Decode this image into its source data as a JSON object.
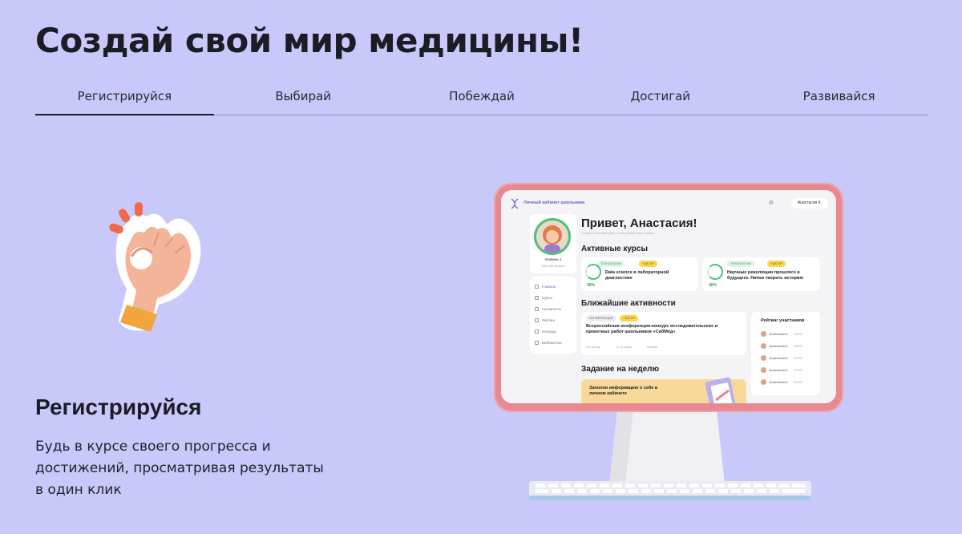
{
  "page": {
    "title": "Создай свой мир медицины!"
  },
  "tabs": [
    {
      "label": "Регистрируйся",
      "active": true
    },
    {
      "label": "Выбирай",
      "active": false
    },
    {
      "label": "Побеждай",
      "active": false
    },
    {
      "label": "Достигай",
      "active": false
    },
    {
      "label": "Развивайся",
      "active": false
    }
  ],
  "section": {
    "title": "Регистрируйся",
    "description": "Будь в курсе своего прогресса и достижений, просматривая результаты в один клик"
  },
  "colors": {
    "background": "#c8c8fa",
    "monitor_frame": "#e88890",
    "accent_purple": "#6a5fd8",
    "accent_green": "#4ec07a",
    "accent_yellow": "#f9d64a"
  },
  "screen": {
    "brand": "Личный кабинет школьника",
    "user": "Анастасия К.",
    "greeting": "Привет, Анастасия!",
    "greeting_sub": "Сегодня отличный день, чтобы узнать много нового",
    "profile": {
      "level": "Уровень 1",
      "bonus": "300 000 баллов"
    },
    "menu": [
      "Главная",
      "Курсы",
      "Активности",
      "Рейтинг",
      "Награды",
      "Библиотека"
    ],
    "active_courses_title": "Активные курсы",
    "courses": [
      {
        "tag": "ТЕХНОЛОГИИ",
        "points": "+100 XP",
        "title": "Data science в лабораторной диагностике",
        "progress": "40%"
      },
      {
        "tag": "ТЕХНОЛОГИИ",
        "points": "+100 XP",
        "title": "Научные революции прошлого и будущего. Начни творить историю",
        "progress": "40%"
      }
    ],
    "activities_title": "Ближайшие активности",
    "activity": {
      "tag": "КОНФЕРЕНЦИЯ",
      "points": "+100 XP",
      "title": "Всероссийская конференция-конкурс исследовательских и проектных работ школьников «СибМед»",
      "date": "25–28 апр",
      "people": "8–12 класс",
      "format": "Онлайн"
    },
    "rating_title": "Рейтинг участников",
    "rating": [
      {
        "name": "Констатин К.",
        "score": "400XP"
      },
      {
        "name": "Констатин К.",
        "score": "390XP"
      },
      {
        "name": "Констатин К.",
        "score": "370XP"
      },
      {
        "name": "Констатин К.",
        "score": "370XP"
      },
      {
        "name": "Констатин К.",
        "score": "350XP"
      }
    ],
    "weekly_task_title": "Задание на неделю",
    "weekly_task": "Заполни информацию о себе в личном кабинете"
  },
  "icons": {
    "ok_hand": "ok-hand-icon",
    "bell": "bell-icon",
    "logo": "dna-logo-icon"
  }
}
